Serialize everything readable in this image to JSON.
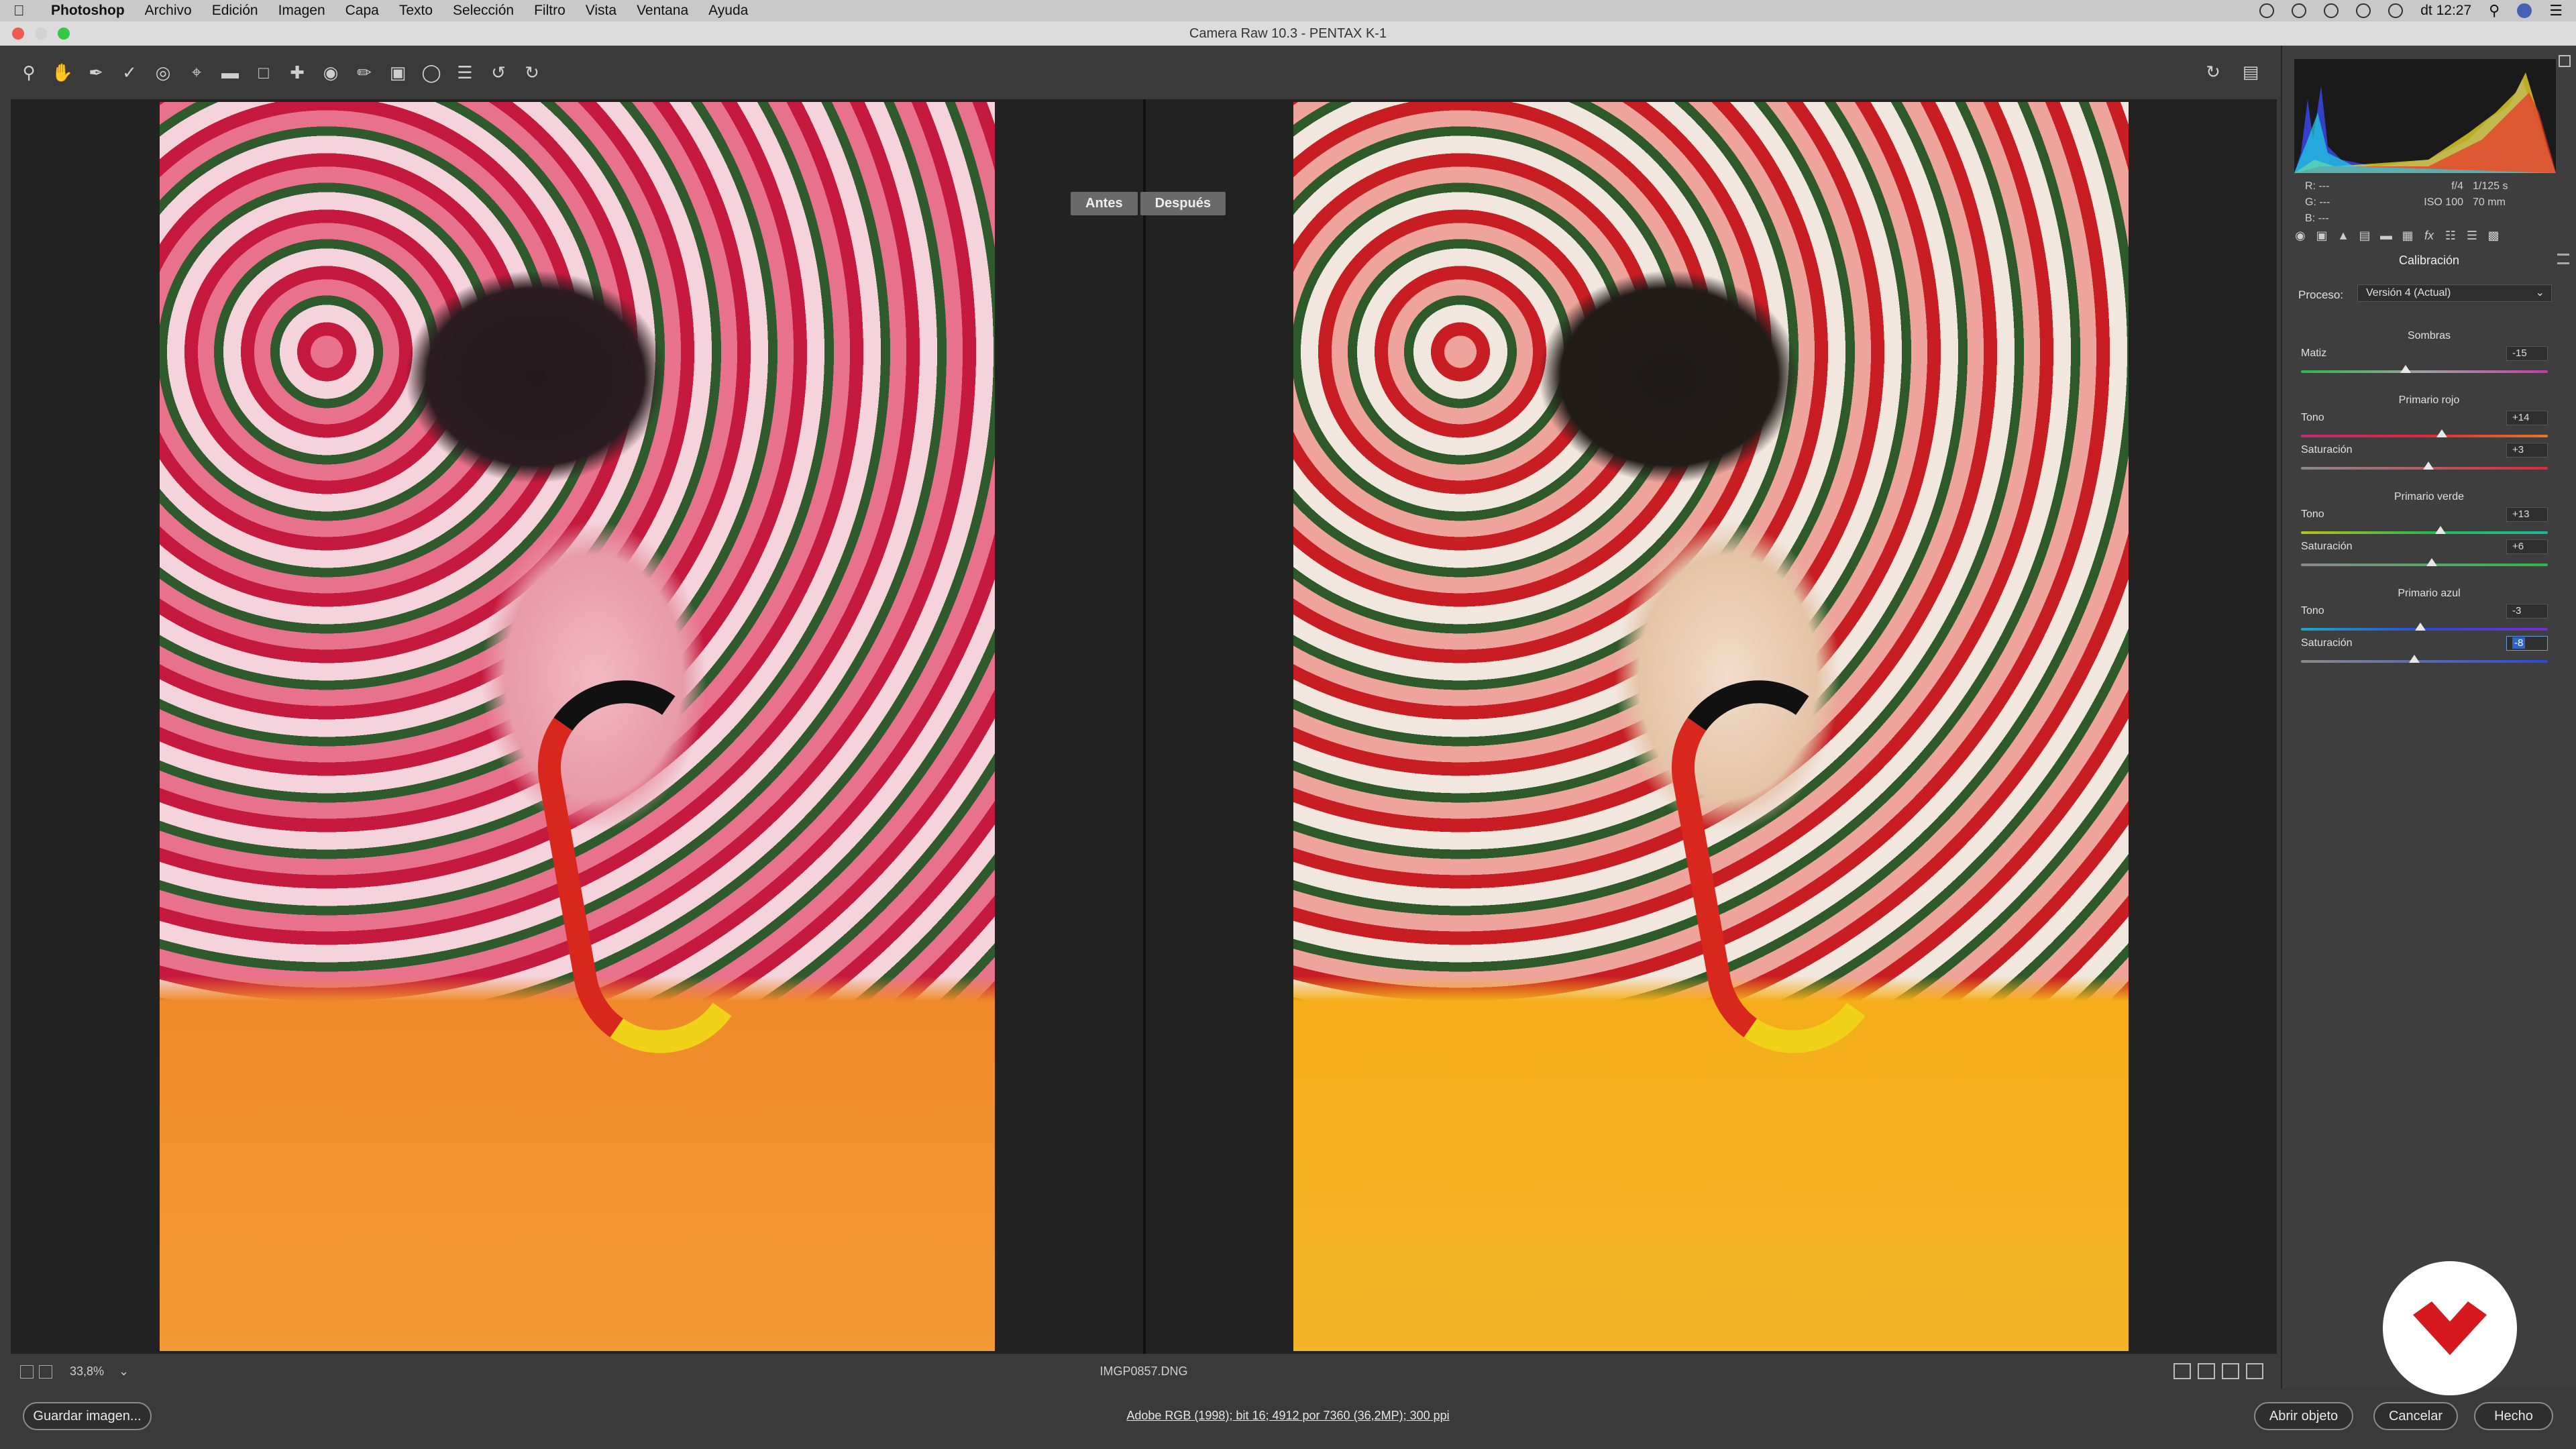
{
  "menubar": {
    "app_name": "Photoshop",
    "items": [
      "Archivo",
      "Edición",
      "Imagen",
      "Capa",
      "Texto",
      "Selección",
      "Filtro",
      "Vista",
      "Ventana",
      "Ayuda"
    ],
    "clock": "dt 12:27"
  },
  "window": {
    "title": "Camera Raw 10.3 -  PENTAX K-1"
  },
  "toolbar": {
    "tools": [
      "zoom-icon",
      "hand-icon",
      "white-balance-icon",
      "color-sampler-icon",
      "target-adjust-icon",
      "crop-icon",
      "straighten-icon",
      "transform-icon",
      "spot-removal-icon",
      "red-eye-icon",
      "adjustment-brush-icon",
      "graduated-filter-icon",
      "radial-filter-icon",
      "preferences-icon",
      "rotate-left-icon",
      "rotate-right-icon"
    ]
  },
  "preview": {
    "before_label": "Antes",
    "after_label": "Después",
    "zoom": "33,8%",
    "filename": "IMGP0857.DNG"
  },
  "histogram": {
    "r": "---",
    "g": "---",
    "b": "---",
    "aperture": "f/4",
    "shutter": "1/125 s",
    "iso": "ISO 100",
    "focal": "70 mm"
  },
  "panel": {
    "title": "Calibración",
    "process_label": "Proceso:",
    "process_value": "Versión 4 (Actual)",
    "sections": [
      {
        "title": "Sombras",
        "sliders": [
          {
            "label": "Matiz",
            "value": "-15",
            "value_num": -15
          }
        ]
      },
      {
        "title": "Primario rojo",
        "sliders": [
          {
            "label": "Tono",
            "value": "+14",
            "value_num": 14
          },
          {
            "label": "Saturación",
            "value": "+3",
            "value_num": 3
          }
        ]
      },
      {
        "title": "Primario verde",
        "sliders": [
          {
            "label": "Tono",
            "value": "+13",
            "value_num": 13
          },
          {
            "label": "Saturación",
            "value": "+6",
            "value_num": 6
          }
        ]
      },
      {
        "title": "Primario azul",
        "sliders": [
          {
            "label": "Tono",
            "value": "-3",
            "value_num": -3
          },
          {
            "label": "Saturación",
            "value": "-8",
            "value_num": -8
          }
        ]
      }
    ]
  },
  "bottom": {
    "save_label": "Guardar imagen...",
    "workflow_info": "Adobe RGB (1998); bit 16; 4912 por 7360 (36,2MP); 300 ppi",
    "open_label": "Abrir objeto",
    "cancel_label": "Cancelar",
    "done_label": "Hecho"
  },
  "colors": {
    "accent": "#2f64c8",
    "panel_bg": "#3e3e3e",
    "brand_red": "#d6181f"
  }
}
